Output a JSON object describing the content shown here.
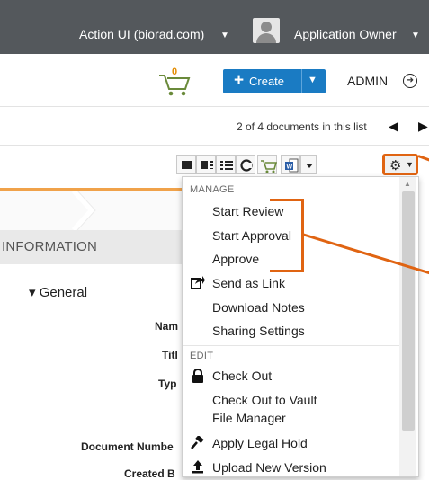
{
  "topbar": {
    "org": "Action UI (biorad.com)",
    "user": "Application Owner",
    "icons": [
      "chevron-down-icon",
      "avatar-icon"
    ]
  },
  "header": {
    "cart_count": "0",
    "create_label": "Create",
    "admin_label": "ADMIN"
  },
  "nav": {
    "position_text": "2 of 4 documents in this list"
  },
  "left": {
    "section_title": "INFORMATION",
    "group": "General",
    "fields": [
      "Nam",
      "Titl",
      "Typ",
      "Document Numbe",
      "Created B"
    ]
  },
  "menu": {
    "manage_header": "MANAGE",
    "start_review": "Start Review",
    "start_approval": "Start Approval",
    "approve": "Approve",
    "send_as_link": "Send as Link",
    "download_notes": "Download Notes",
    "sharing_settings": "Sharing Settings",
    "edit_header": "EDIT",
    "check_out": "Check Out",
    "check_out_vault_line1": "Check Out to Vault",
    "check_out_vault_line2": "File Manager",
    "apply_legal_hold": "Apply Legal Hold",
    "upload_new_version": "Upload New Version"
  },
  "colors": {
    "topbar": "#54585c",
    "create": "#1a7bc3",
    "callout": "#e06412"
  }
}
